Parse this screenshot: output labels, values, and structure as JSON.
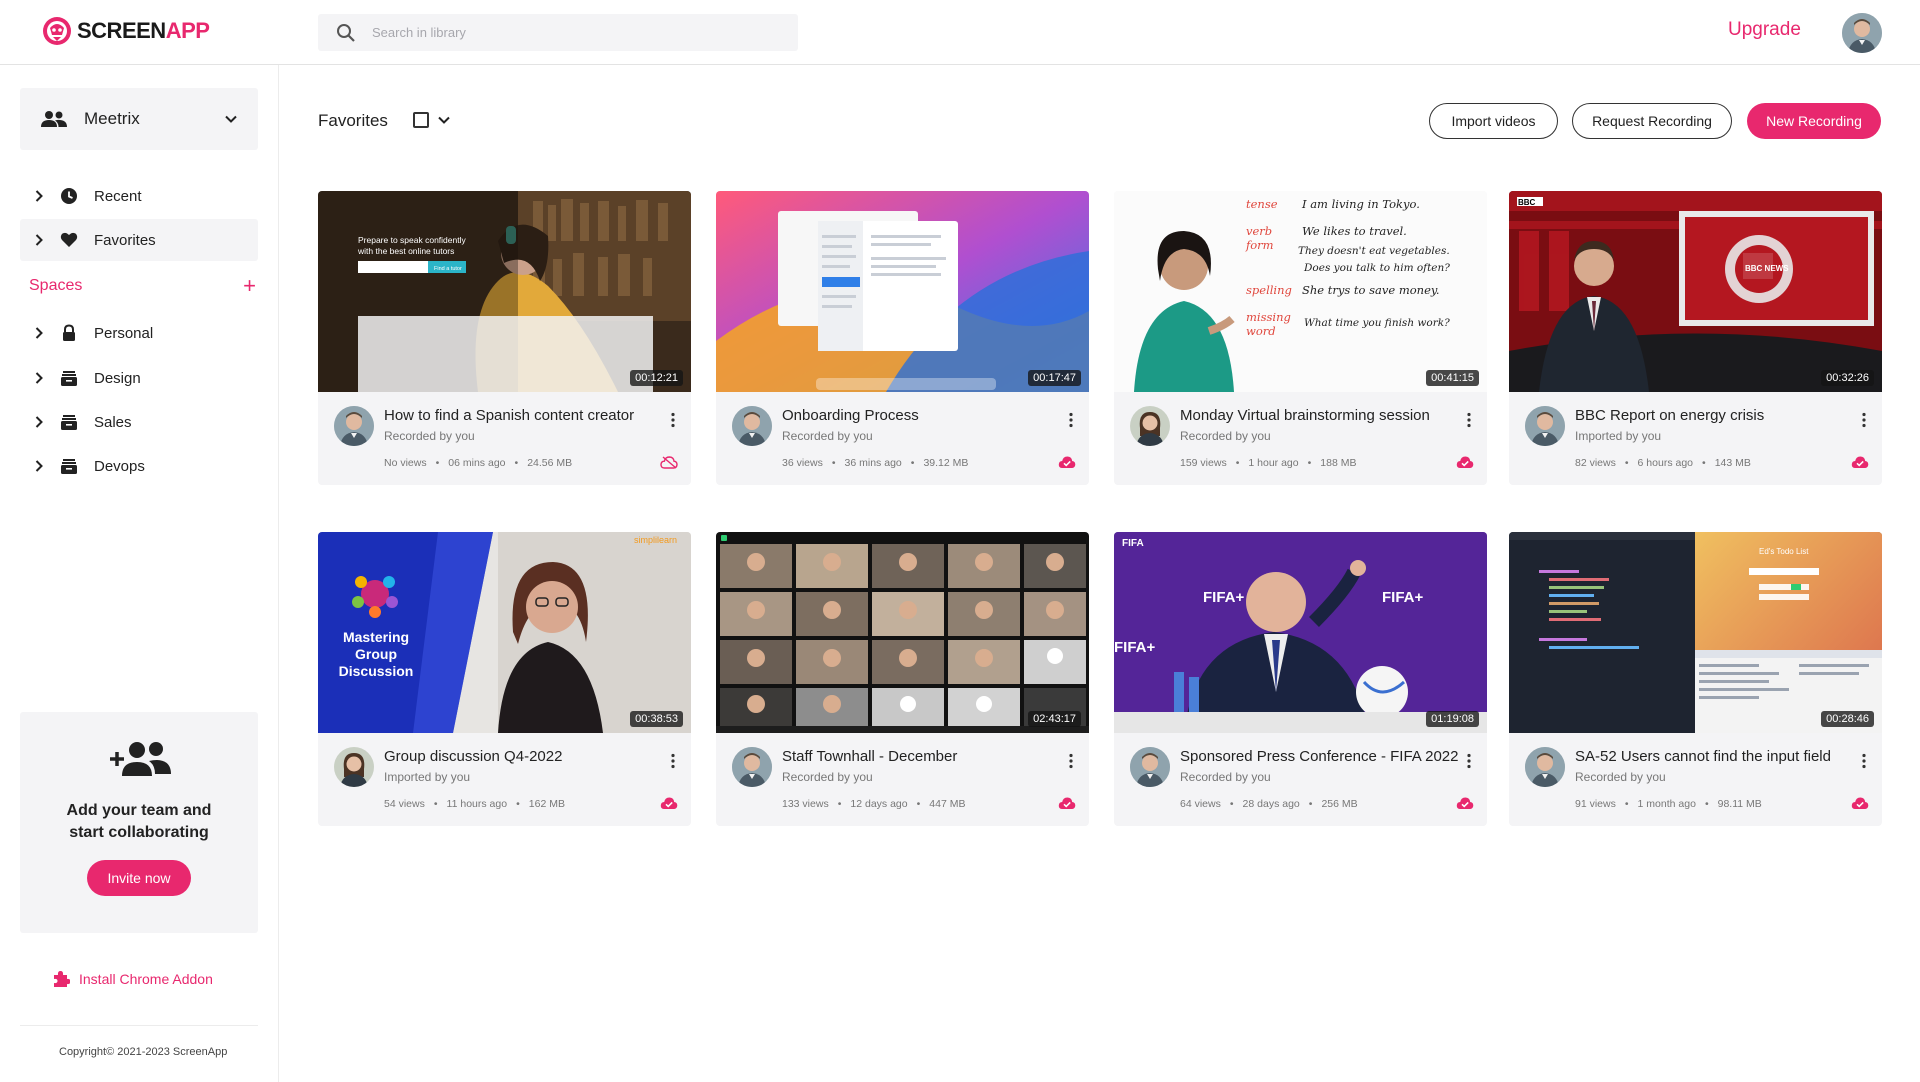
{
  "header": {
    "logo_text_a": "SCREEN",
    "logo_text_b": "APP",
    "search_placeholder": "Search in library",
    "upgrade_label": "Upgrade",
    "brand_color": "#e8286e"
  },
  "sidebar": {
    "workspace_name": "Meetrix",
    "nav": [
      {
        "label": "Recent",
        "icon": "clock-icon"
      },
      {
        "label": "Favorites",
        "icon": "heart-icon"
      }
    ],
    "spaces_label": "Spaces",
    "spaces_add": "+",
    "spaces": [
      {
        "label": "Personal",
        "icon": "lock-icon"
      },
      {
        "label": "Design",
        "icon": "stack-icon"
      },
      {
        "label": "Sales",
        "icon": "stack-icon"
      },
      {
        "label": "Devops",
        "icon": "stack-icon"
      }
    ],
    "invite": {
      "line1": "Add your team and",
      "line2": "start collaborating",
      "button": "Invite now"
    },
    "chrome_addon": "Install Chrome Addon",
    "copyright": "Copyright© 2021-2023 ScreenApp"
  },
  "toolbar": {
    "title": "Favorites",
    "import_label": "Import videos",
    "request_label": "Request Recording",
    "new_label": "New Recording"
  },
  "videos": [
    {
      "title": "How to find a Spanish content creator",
      "sub": "Recorded by you",
      "views": "No views",
      "age": "06 mins ago",
      "size": "24.56 MB",
      "duration": "00:12:21",
      "cloud": "outline"
    },
    {
      "title": "Onboarding Process",
      "sub": "Recorded by you",
      "views": "36 views",
      "age": "36 mins ago",
      "size": "39.12 MB",
      "duration": "00:17:47",
      "cloud": "filled"
    },
    {
      "title": "Monday Virtual brainstorming session",
      "sub": "Recorded by you",
      "views": "159 views",
      "age": "1 hour ago",
      "size": "188 MB",
      "duration": "00:41:15",
      "cloud": "filled"
    },
    {
      "title": "BBC Report on energy crisis",
      "sub": "Imported by you",
      "views": "82 views",
      "age": "6 hours ago",
      "size": "143 MB",
      "duration": "00:32:26",
      "cloud": "filled"
    },
    {
      "title": "Group discussion Q4-2022",
      "sub": "Imported by you",
      "views": "54 views",
      "age": "11 hours ago",
      "size": "162 MB",
      "duration": "00:38:53",
      "cloud": "filled"
    },
    {
      "title": "Staff Townhall - December",
      "sub": "Recorded by you",
      "views": "133 views",
      "age": "12 days ago",
      "size": "447 MB",
      "duration": "02:43:17",
      "cloud": "filled"
    },
    {
      "title": "Sponsored Press Conference - FIFA 2022",
      "sub": "Recorded by you",
      "views": "64 views",
      "age": "28 days ago",
      "size": "256 MB",
      "duration": "01:19:08",
      "cloud": "filled"
    },
    {
      "title": "SA-52 Users cannot find the input field",
      "sub": "Recorded by you",
      "views": "91 views",
      "age": "1 month ago",
      "size": "98.11 MB",
      "duration": "00:28:46",
      "cloud": "filled"
    }
  ],
  "thumb_text": {
    "t1_line1": "Prepare to speak confidently",
    "t1_line2": "with the best online tutors",
    "t1_btn": "Find a tutor",
    "t3_l1": "tense",
    "t3_l2": "I am living in Tokyo.",
    "t3_l3": "verb",
    "t3_l4": "We likes to travel.",
    "t3_l5": "form",
    "t3_l6": "They doesn't eat vegetables.",
    "t3_l7": "Does you talk to him often?",
    "t3_l8": "spelling",
    "t3_l9": "She trys to save money.",
    "t3_l10": "missing",
    "t3_l11": "word",
    "t3_l12": "What time you finish work?",
    "t4_logo": "BBC",
    "t4_news": "BBC NEWS",
    "t5_l1": "Mastering",
    "t5_l2": "Group",
    "t5_l3": "Discussion",
    "t5_brand": "simplilearn",
    "t7_fifa": "FIFA",
    "t7_plus": "FIFA+",
    "t8_title": "Ed's Todo List"
  }
}
